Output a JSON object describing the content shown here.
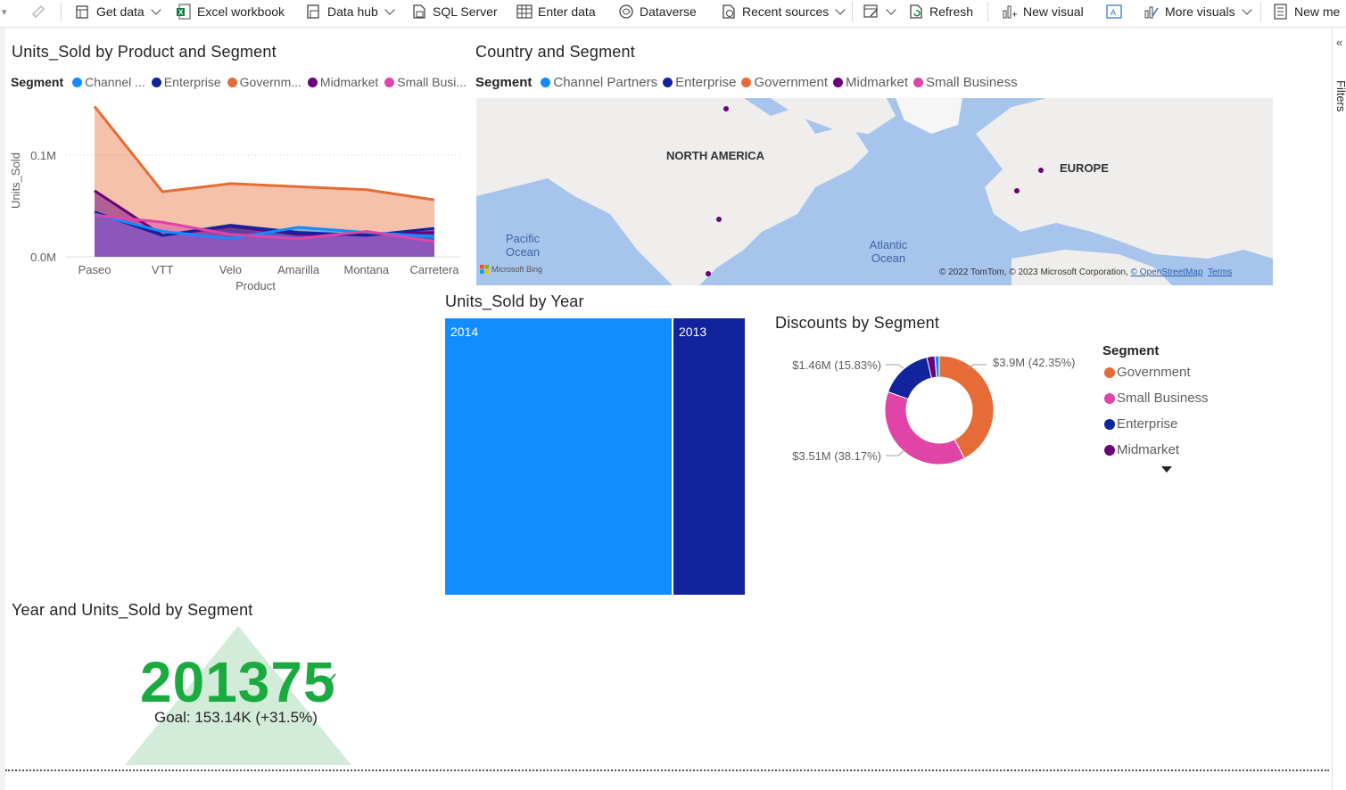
{
  "ribbon": {
    "items": [
      {
        "label": "Get data",
        "icon": "database-icon",
        "dropdown": true
      },
      {
        "label": "Excel workbook",
        "icon": "excel-icon",
        "dropdown": false
      },
      {
        "label": "Data hub",
        "icon": "data-hub-icon",
        "dropdown": true
      },
      {
        "label": "SQL Server",
        "icon": "sql-server-icon",
        "dropdown": false
      },
      {
        "label": "Enter data",
        "icon": "table-icon",
        "dropdown": false
      },
      {
        "label": "Dataverse",
        "icon": "dataverse-icon",
        "dropdown": false
      },
      {
        "label": "Recent sources",
        "icon": "recent-sources-icon",
        "dropdown": true
      },
      {
        "label": "Refresh",
        "icon": "refresh-icon",
        "dropdown": false
      },
      {
        "label": "New visual",
        "icon": "new-visual-icon",
        "dropdown": false
      },
      {
        "label": "More visuals",
        "icon": "more-visuals-icon",
        "dropdown": true
      },
      {
        "label": "New me",
        "icon": "new-measure-icon",
        "dropdown": false
      }
    ]
  },
  "filters_pane": {
    "label": "Filters"
  },
  "segment_colors": {
    "Channel Partners": "#118dff",
    "Enterprise": "#12239e",
    "Government": "#e66c37",
    "Midmarket": "#6b007b",
    "Small Business": "#e044a7"
  },
  "line_chart": {
    "title": "Units_Sold by Product and Segment",
    "legend_title": "Segment",
    "legend_labels": [
      "Channel ...",
      "Enterprise",
      "Governm...",
      "Midmarket",
      "Small Busi..."
    ],
    "y_ticks": [
      "0.1M",
      "0.0M"
    ]
  },
  "map_visual": {
    "title": "Country and Segment",
    "legend_title": "Segment",
    "legend_labels": [
      "Channel Partners",
      "Enterprise",
      "Government",
      "Midmarket",
      "Small Business"
    ],
    "labels": {
      "north_america": "NORTH AMERICA",
      "europe": "EUROPE",
      "pacific": "Pacific Ocean",
      "atlantic": "Atlantic Ocean"
    },
    "bing_label": "Microsoft Bing",
    "attribution": "© 2022 TomTom, © 2023 Microsoft Corporation, ",
    "osm_link": "© OpenStreetMap",
    "terms_link": "Terms"
  },
  "treemap": {
    "title": "Units_Sold by Year",
    "items": [
      {
        "label": "2014",
        "color": "#118dff",
        "share": 0.76
      },
      {
        "label": "2013",
        "color": "#12239e",
        "share": 0.24
      }
    ]
  },
  "donut": {
    "title": "Discounts by Segment",
    "legend_title": "Segment",
    "legend_items": [
      "Government",
      "Small Business",
      "Enterprise",
      "Midmarket"
    ],
    "data_labels": [
      "$3.9M (42.35%)",
      "$1.46M (15.83%)",
      "$3.51M (38.17%)"
    ]
  },
  "kpi": {
    "title": "Year and Units_Sold by Segment",
    "value": "201375",
    "goal_text": "Goal: 153.14K (+31.5%)",
    "status_color": "#1aab40"
  },
  "chart_data": [
    {
      "type": "line",
      "title": "Units_Sold by Product and Segment",
      "xlabel": "Product",
      "ylabel": "Units_Sold",
      "categories": [
        "Paseo",
        "VTT",
        "Velo",
        "Amarilla",
        "Montana",
        "Carretera"
      ],
      "ylim": [
        0,
        0.15
      ],
      "y_unit": "M",
      "legend_position": "top",
      "grid": true,
      "series": [
        {
          "name": "Government",
          "values": [
            0.148,
            0.064,
            0.072,
            0.069,
            0.066,
            0.056
          ]
        },
        {
          "name": "Midmarket",
          "values": [
            0.065,
            0.021,
            0.03,
            0.022,
            0.022,
            0.024
          ]
        },
        {
          "name": "Enterprise",
          "values": [
            0.044,
            0.021,
            0.031,
            0.024,
            0.021,
            0.028
          ]
        },
        {
          "name": "Channel Partners",
          "values": [
            0.042,
            0.025,
            0.018,
            0.029,
            0.024,
            0.02
          ]
        },
        {
          "name": "Small Business",
          "values": [
            0.041,
            0.034,
            0.022,
            0.018,
            0.025,
            0.015
          ]
        }
      ]
    },
    {
      "type": "pie",
      "title": "Discounts by Segment",
      "categories": [
        "Government",
        "Small Business",
        "Enterprise",
        "Midmarket",
        "Channel Partners"
      ],
      "values": [
        3.9,
        3.51,
        1.46,
        0.22,
        0.12
      ],
      "value_unit": "$M",
      "percent": [
        42.35,
        38.17,
        15.83,
        2.4,
        1.25
      ],
      "donut": true
    }
  ]
}
